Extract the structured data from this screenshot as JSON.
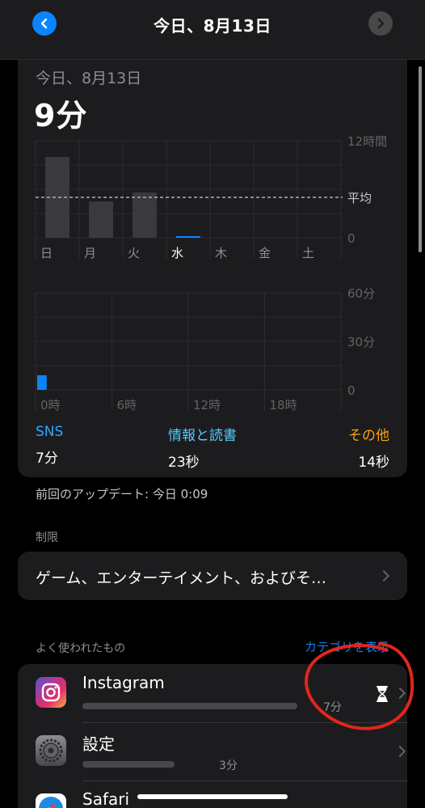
{
  "header": {
    "title": "今日、8月13日"
  },
  "summary": {
    "date": "今日、8月13日",
    "total": "9分"
  },
  "chart_data": [
    {
      "type": "bar",
      "categories": [
        "日",
        "月",
        "火",
        "水",
        "木",
        "金",
        "土"
      ],
      "values": [
        10.0,
        4.5,
        5.6,
        0.1,
        0,
        0,
        0
      ],
      "average": 5.0,
      "y_tick_labels": [
        "12時間",
        "平均",
        "0"
      ],
      "ylim": [
        0,
        12
      ],
      "highlight_category": "水"
    },
    {
      "type": "bar",
      "categories": [
        "0時",
        "6時",
        "12時",
        "18時"
      ],
      "bins": 24,
      "values": [
        9,
        0,
        0,
        0,
        0,
        0,
        0,
        0,
        0,
        0,
        0,
        0,
        0,
        0,
        0,
        0,
        0,
        0,
        0,
        0,
        0,
        0,
        0,
        0
      ],
      "y_tick_labels": [
        "60分",
        "30分",
        "0"
      ],
      "ylim": [
        0,
        60
      ]
    }
  ],
  "categories": [
    {
      "name": "SNS",
      "value": "7分"
    },
    {
      "name": "情報と読書",
      "value": "23秒"
    },
    {
      "name": "その他",
      "value": "14秒"
    }
  ],
  "updated": "前回のアップデート: 今日 0:09",
  "limits": {
    "label": "制限",
    "item": "ゲーム、エンターテイメント、およびそ…"
  },
  "most_used": {
    "label": "よく使われたもの",
    "show_categories": "カテゴリを表示",
    "apps": [
      {
        "name": "Instagram",
        "time": "7分",
        "fill": 0.7
      },
      {
        "name": "設定",
        "time": "3分",
        "fill": 0.3
      },
      {
        "name": "Safari",
        "time": "",
        "fill": 0.05
      }
    ]
  },
  "colors": {
    "accent": "#0a84ff",
    "sns": "#32a7ff",
    "info": "#5ac8fa",
    "other": "#ff9f0a",
    "bar": "#3a3a3c",
    "annotation": "#e0261b"
  }
}
